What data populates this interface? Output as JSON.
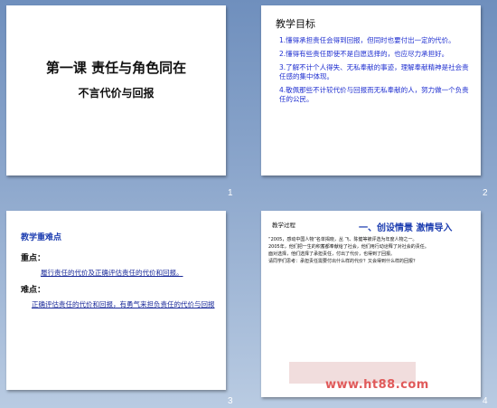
{
  "slides": [
    {
      "number": "1",
      "title": "第一课 责任与角色同在",
      "subtitle": "不言代价与回报"
    },
    {
      "number": "2",
      "title": "教学目标",
      "items": [
        "1.懂得承担责任会得到回报，但同时也要付出一定的代价。",
        "2.懂得有些责任即使不是自愿选择的，也应尽力承担好。",
        "3.了解不计个人得失、无私奉献的事迹，理解奉献精神是社会责任感的集中体现。",
        "4.敬佩那些不计较代价与回报而无私奉献的人，努力做一个负责任的公民。"
      ]
    },
    {
      "number": "3",
      "title": "教学重难点",
      "key_label": "重点：",
      "key_text": "履行责任的代价及正确评估责任的代价和回报。",
      "diff_label": "难点：",
      "diff_text": "正确评估责任的代价和回报，有勇气来担负责任的代价与回报"
    },
    {
      "number": "4",
      "label": "教学过程",
      "heading": "一、创设情景 激情导入",
      "paragraphs": [
        "“2005，感动中国人物”名单揭晓，丛 飞、陈健等被评选为年度人物之一。",
        "2005年，他们把一生的积蓄都奉献给了社会，他们用行动诠释了对社会的责任。",
        "面对选择，他们选择了承担责任，付出了代价，也得到了回报。",
        "请同学们思考：承担责任需要付出什么样的代价？又会得到什么样的回报？"
      ],
      "watermark": "www.ht88.com"
    }
  ]
}
